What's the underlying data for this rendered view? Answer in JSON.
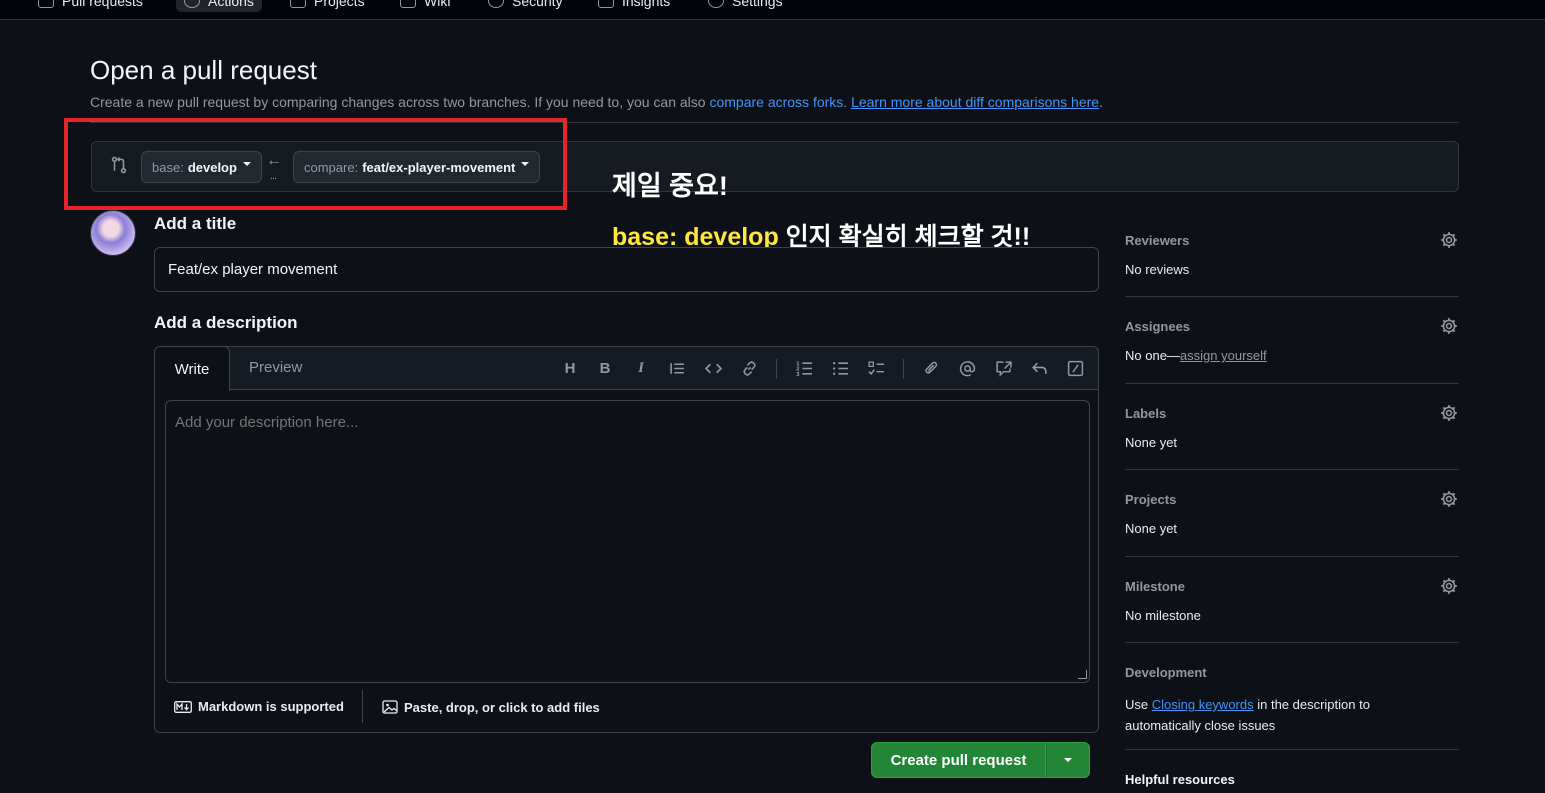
{
  "topnav": {
    "tabs": [
      {
        "label": "Pull requests"
      },
      {
        "label": "Actions"
      },
      {
        "label": "Projects"
      },
      {
        "label": "Wiki"
      },
      {
        "label": "Security"
      },
      {
        "label": "Insights"
      },
      {
        "label": "Settings"
      }
    ]
  },
  "header": {
    "title": "Open a pull request",
    "subtitle_text": "Create a new pull request by comparing changes across two branches. If you need to, you can also ",
    "compare_forks_link": "compare across forks.",
    "learn_more_link": "Learn more about diff comparisons here",
    "subtitle_end": "."
  },
  "range": {
    "base_prefix": "base:",
    "base_branch": "develop",
    "arrow": "←",
    "dots": "...",
    "compare_prefix": "compare:",
    "compare_branch": "feat/ex-player-movement"
  },
  "annotation": {
    "line1": "제일 중요!",
    "line2_highlight": "base: develop",
    "line2_rest": " 인지 확실히 체크할 것!!",
    "box_color": "#e3262b",
    "highlight_color": "#ffe83a"
  },
  "form": {
    "title_label": "Add a title",
    "title_value": "Feat/ex player movement",
    "description_label": "Add a description",
    "tab_write": "Write",
    "tab_preview": "Preview",
    "toolbar": {
      "heading": "H",
      "bold": "B",
      "italic": "I"
    },
    "description_placeholder": "Add your description here...",
    "markdown_note": "Markdown is supported",
    "attach_note": "Paste, drop, or click to add files",
    "submit_label": "Create pull request"
  },
  "sidebar": {
    "reviewers": {
      "title": "Reviewers",
      "value": "No reviews"
    },
    "assignees": {
      "title": "Assignees",
      "value": "No one—",
      "link": "assign yourself"
    },
    "labels": {
      "title": "Labels",
      "value": "None yet"
    },
    "projects": {
      "title": "Projects",
      "value": "None yet"
    },
    "milestone": {
      "title": "Milestone",
      "value": "No milestone"
    },
    "development": {
      "title": "Development",
      "text_before": "Use ",
      "link": "Closing keywords",
      "text_after": " in the description to automatically close issues"
    },
    "helpful": "Helpful resources"
  },
  "colors": {
    "background": "#0d1117",
    "accent_link": "#4493f8",
    "primary_button": "#238636"
  }
}
